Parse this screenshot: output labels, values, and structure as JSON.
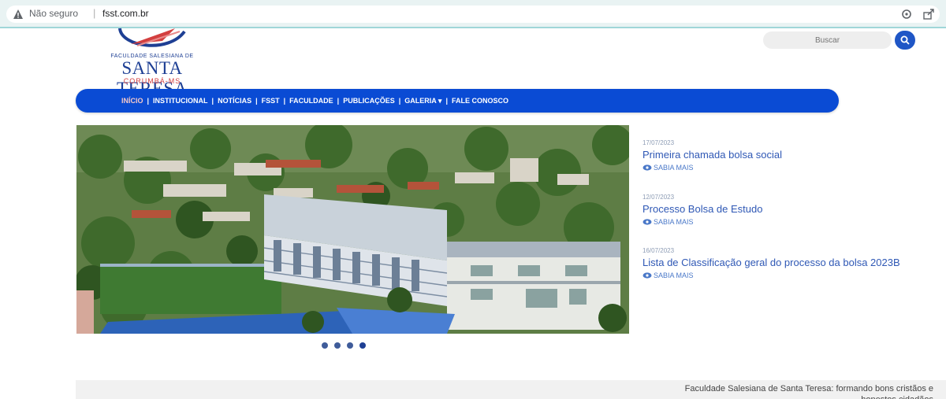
{
  "browser": {
    "security_label": "Não seguro",
    "url": "fsst.com.br"
  },
  "logo": {
    "small_text": "FACULDADE SALESIANA DE",
    "name": "SANTA TERESA",
    "city": "CORUMBÁ-MS"
  },
  "search": {
    "placeholder": "Buscar"
  },
  "nav": {
    "items": [
      "INÍCIO",
      "INSTITUCIONAL",
      "NOTÍCIAS",
      "FSST",
      "FACULDADE",
      "PUBLICAÇÕES",
      "GALERIA ▾",
      "FALE CONOSCO"
    ]
  },
  "carousel": {
    "slides": 4,
    "active_slide": 4
  },
  "news": [
    {
      "date": "17/07/2023",
      "title": "Primeira chamada bolsa social",
      "author": "SABIA MAIS"
    },
    {
      "date": "12/07/2023",
      "title": "Processo Bolsa de Estudo",
      "author": "SABIA MAIS"
    },
    {
      "date": "16/07/2023",
      "title": "Lista de Classificação geral do processo da bolsa 2023B",
      "author": "SABIA MAIS"
    }
  ],
  "footer": {
    "text": "Faculdade Salesiana de Santa Teresa: formando bons cristãos e honestos cidadãos"
  },
  "colors": {
    "nav_blue": "#0a4bd4",
    "logo_blue": "#1e3f94",
    "logo_red": "#d33f3f",
    "news_title": "#2f58b5"
  }
}
